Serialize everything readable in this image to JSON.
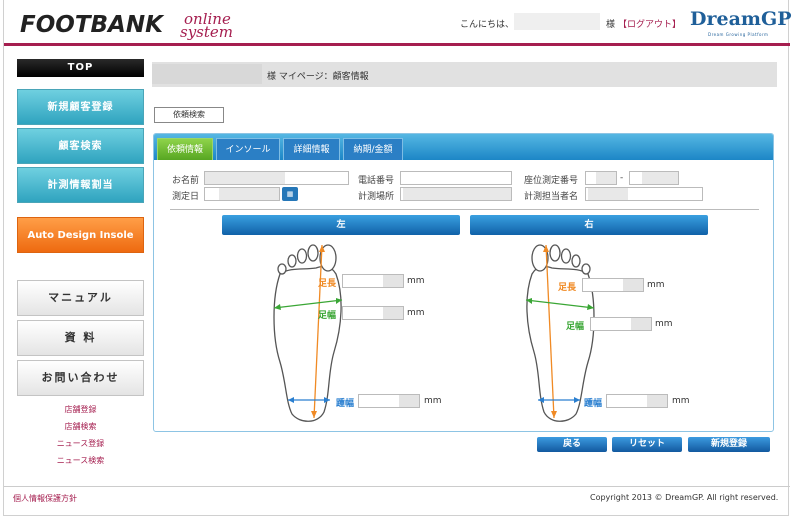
{
  "header": {
    "logo_main": "FOOTBANK",
    "logo_sub1": "online",
    "logo_sub2": "system",
    "greeting": "こんにちは、",
    "honorific": "様",
    "logout": "【ログアウト】",
    "dream_logo": "DreamGP",
    "dream_tagline": "Dream Growing Platform"
  },
  "sidebar": {
    "top": "TOP",
    "buttons": [
      "新規顧客登録",
      "顧客検索",
      "計測情報割当"
    ],
    "auto_design": "Auto Design Insole",
    "gray_buttons": [
      "マニュアル",
      "資 料",
      "お問い合わせ"
    ],
    "links": [
      "店舗登録",
      "店舗検索",
      "ニュース登録",
      "ニュース検索"
    ]
  },
  "title_bar": {
    "text": "様 マイページ：顧客情報"
  },
  "request_search": "依頼検索",
  "tabs": [
    {
      "label": "依頼情報",
      "active": true
    },
    {
      "label": "インソール",
      "active": false
    },
    {
      "label": "詳細情報",
      "active": false
    },
    {
      "label": "納期/金額",
      "active": false
    }
  ],
  "form": {
    "name_label": "お名前",
    "phone_label": "電話番号",
    "seat_label": "座位測定番号",
    "seat_sep": "-",
    "date_label": "測定日",
    "place_label": "計測場所",
    "staff_label": "計測担当者名",
    "calendar_icon": "calendar-icon"
  },
  "feet": {
    "left_title": "左",
    "right_title": "右",
    "foot_length": "足長",
    "foot_width": "足幅",
    "heel_width": "踵幅",
    "unit": "mm"
  },
  "actions": {
    "back": "戻る",
    "reset": "リセット",
    "register": "新規登録"
  },
  "footer": {
    "privacy": "個人情報保護方針",
    "copyright": "Copyright 2013 © DreamGP. All right reserved."
  },
  "colors": {
    "brand": "#a51e4f",
    "tab_active": "#6bbb32",
    "blue": "#1c86c6",
    "orange": "#ee6a10",
    "length_line": "#f08a24",
    "width_line": "#3aa635",
    "heel_line": "#2a7fd0"
  }
}
